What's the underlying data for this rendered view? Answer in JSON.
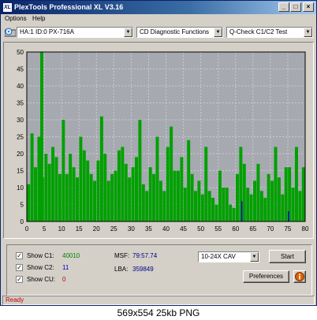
{
  "window": {
    "title": "PlexTools Professional XL V3.16",
    "app_icon_text": "XL",
    "minimize": "_",
    "maximize": "□",
    "close": "×"
  },
  "menu": {
    "items": [
      "Options",
      "Help"
    ]
  },
  "toolbar": {
    "drive_icon": "cd-drive-icon",
    "drive": "HA:1 ID:0  PX-716A",
    "function": "CD Diagnostic Functions",
    "test": "Q-Check C1/C2 Test",
    "dropdown_glyph": "▼"
  },
  "chart_data": {
    "type": "bar",
    "xlim": [
      0,
      80
    ],
    "ylim": [
      0,
      50
    ],
    "x_ticks": [
      0,
      5,
      10,
      15,
      20,
      25,
      30,
      35,
      40,
      45,
      50,
      55,
      60,
      65,
      70,
      75,
      80
    ],
    "y_ticks": [
      0,
      5,
      10,
      15,
      20,
      25,
      30,
      35,
      40,
      45,
      50
    ],
    "grid": true,
    "scan_end_minute": 80,
    "series": [
      {
        "name": "C1",
        "color": "#00a000",
        "x": [
          0.5,
          1.5,
          2.5,
          3.5,
          4.3,
          4.5,
          5.5,
          6.5,
          7.5,
          8.5,
          9.5,
          10.5,
          11.5,
          12.5,
          13.5,
          14.5,
          15.5,
          16.5,
          17.5,
          18.5,
          19.5,
          20.5,
          21.5,
          22.5,
          23.5,
          24.5,
          25.5,
          26.5,
          27.5,
          28.5,
          29.5,
          30.5,
          31.5,
          32.5,
          33.5,
          34.5,
          35.5,
          36.5,
          37.5,
          38.5,
          39.5,
          40.5,
          41.5,
          42.5,
          43.5,
          44.5,
          45.5,
          46.5,
          47.5,
          48.5,
          49.5,
          50.5,
          51.5,
          52.5,
          53.5,
          54.5,
          55.5,
          56.5,
          57.5,
          58.5,
          59.5,
          60.5,
          61.5,
          62.5,
          63.5,
          64.5,
          65.5,
          66.5,
          67.5,
          68.5,
          69.5,
          70.5,
          71.5,
          72.5,
          73.5,
          74.5,
          75.5,
          76.5,
          77.5,
          78.5,
          79.5
        ],
        "y": [
          11,
          26,
          16,
          25,
          50,
          13,
          20,
          17,
          22,
          19,
          14,
          30,
          14,
          20,
          16,
          13,
          25,
          21,
          18,
          14,
          12,
          18,
          31,
          20,
          12,
          14,
          15,
          21,
          22,
          17,
          13,
          16,
          19,
          30,
          11,
          9,
          16,
          14,
          25,
          12,
          9,
          22,
          28,
          15,
          15,
          19,
          10,
          24,
          14,
          9,
          12,
          8,
          22,
          9,
          7,
          5,
          15,
          10,
          10,
          5,
          4,
          14,
          22,
          17,
          10,
          8,
          12,
          17,
          9,
          7,
          14,
          12,
          22,
          13,
          8,
          16,
          16,
          10,
          22,
          9,
          16
        ]
      },
      {
        "name": "C2",
        "color": "#0000c0",
        "x": [
          61.8,
          75.2
        ],
        "y": [
          6,
          3
        ]
      }
    ]
  },
  "controls": {
    "show_c1_label": "Show C1:",
    "show_c1_value": "40010",
    "show_c1_checked": "✓",
    "show_c2_label": "Show C2:",
    "show_c2_value": "11",
    "show_c2_checked": "✓",
    "show_cu_label": "Show CU:",
    "show_cu_value": "0",
    "show_cu_checked": "✓",
    "msf_label": "MSF:",
    "msf_value": "79:57.74",
    "lba_label": "LBA:",
    "lba_value": "359849",
    "speed": "10-24X CAV",
    "start_label": "Start",
    "preferences_label": "Preferences",
    "info_icon": "info-icon",
    "colors": {
      "c1": "#008000",
      "c2": "#0000c0",
      "cu": "#c00000",
      "data_value": "#000080"
    }
  },
  "status": {
    "text": "Ready"
  },
  "caption": "569x554  25kb  PNG"
}
